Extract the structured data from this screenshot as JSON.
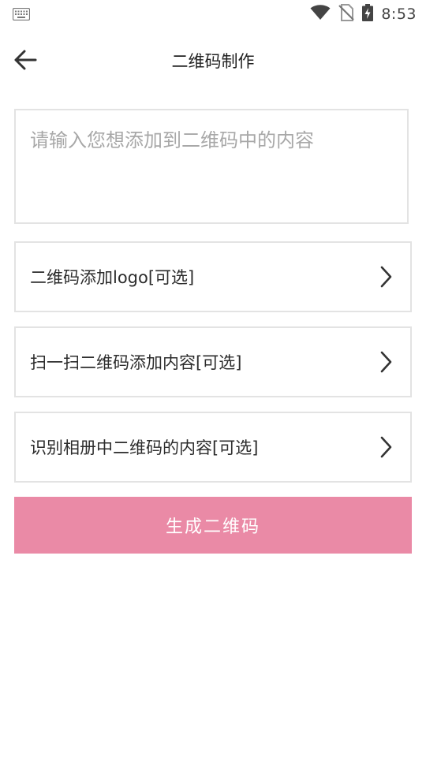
{
  "status_bar": {
    "time": "8:53",
    "icons": [
      "keyboard-icon",
      "wifi-icon",
      "no-sim-icon",
      "battery-charging-icon"
    ]
  },
  "header": {
    "back_icon": "arrow-left-icon",
    "title": "二维码制作"
  },
  "content_input": {
    "value": "",
    "placeholder": "请输入您想添加到二维码中的内容"
  },
  "options": [
    {
      "label": "二维码添加logo[可选]",
      "icon": "chevron-right-icon"
    },
    {
      "label": "扫一扫二维码添加内容[可选]",
      "icon": "chevron-right-icon"
    },
    {
      "label": "识别相册中二维码的内容[可选]",
      "icon": "chevron-right-icon"
    }
  ],
  "generate_button": {
    "label": "生成二维码",
    "color": "#ea8aa6"
  }
}
